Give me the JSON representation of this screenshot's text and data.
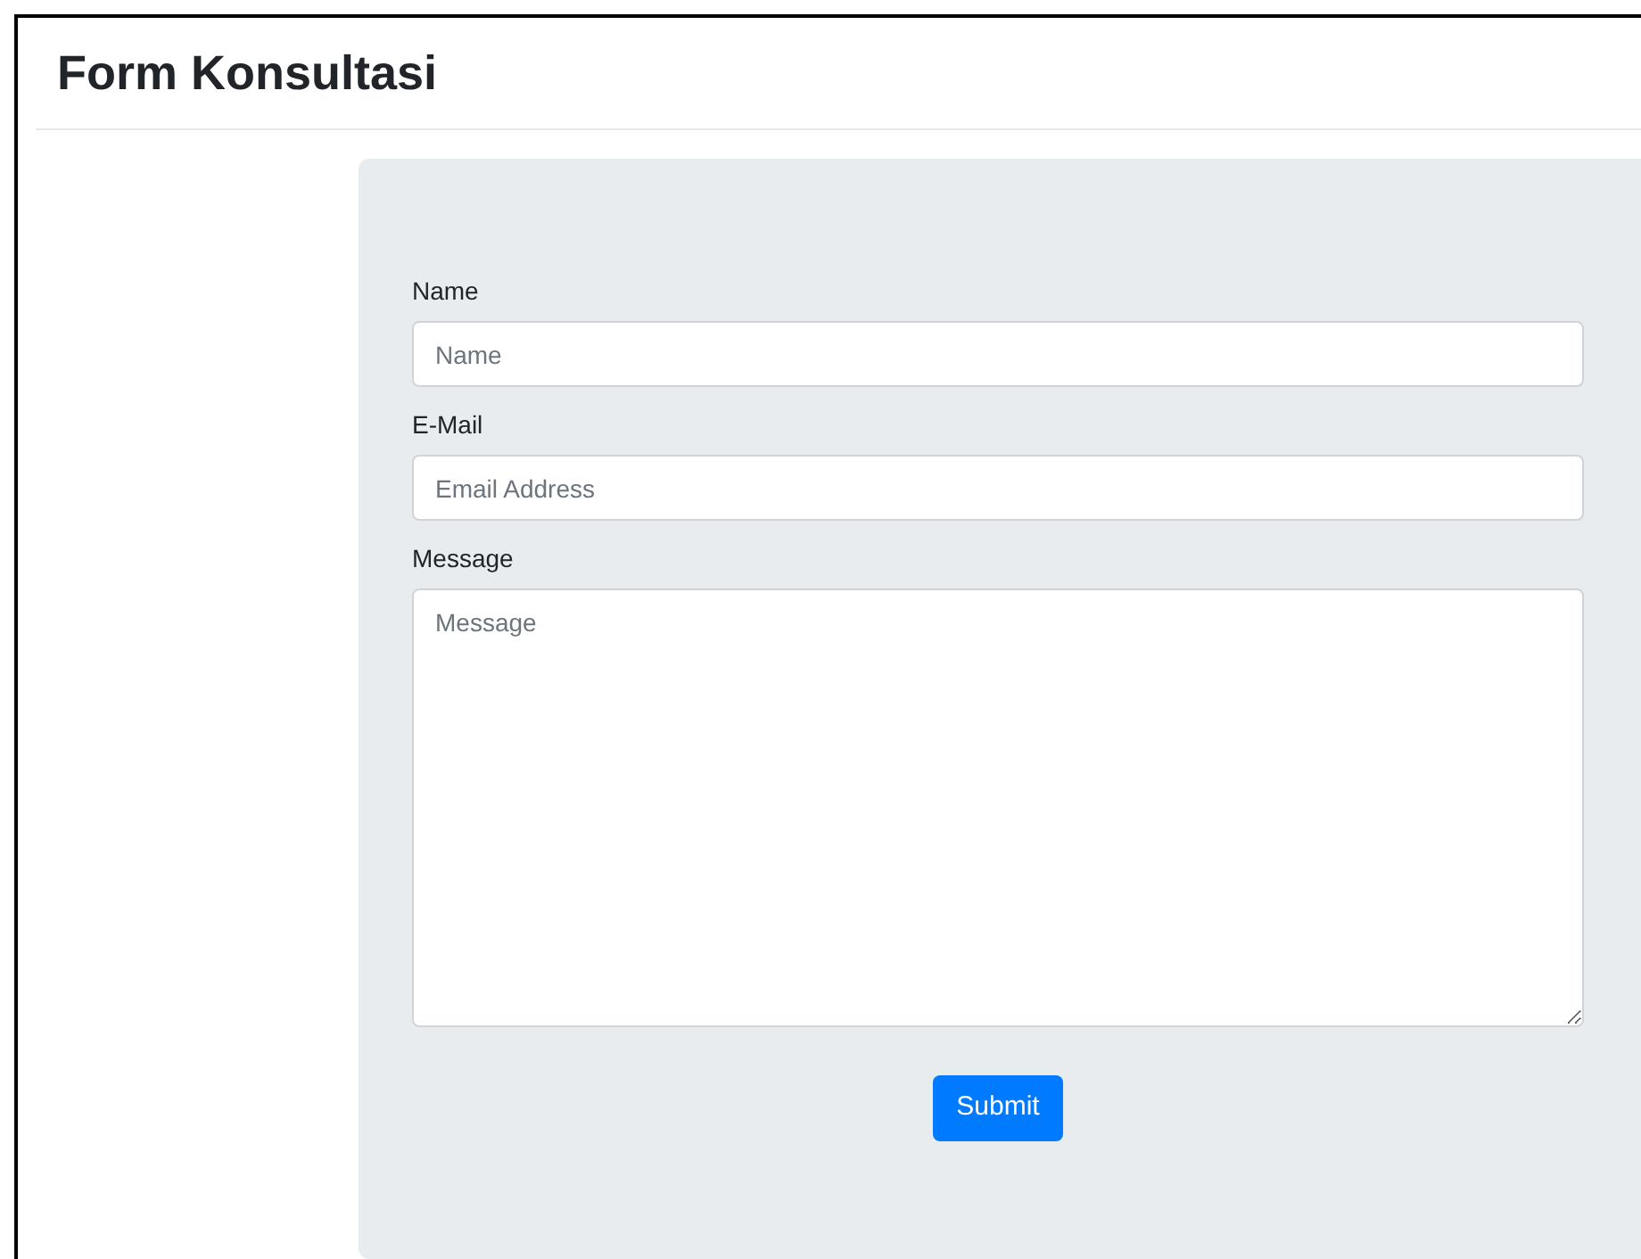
{
  "page": {
    "title": "Form Konsultasi"
  },
  "form": {
    "fields": [
      {
        "kind": "input",
        "label": "Name",
        "placeholder": "Name"
      },
      {
        "kind": "input",
        "label": "E-Mail",
        "placeholder": "Email Address"
      },
      {
        "kind": "textarea",
        "label": "Message",
        "placeholder": "Message"
      }
    ],
    "submit": "Submit"
  }
}
